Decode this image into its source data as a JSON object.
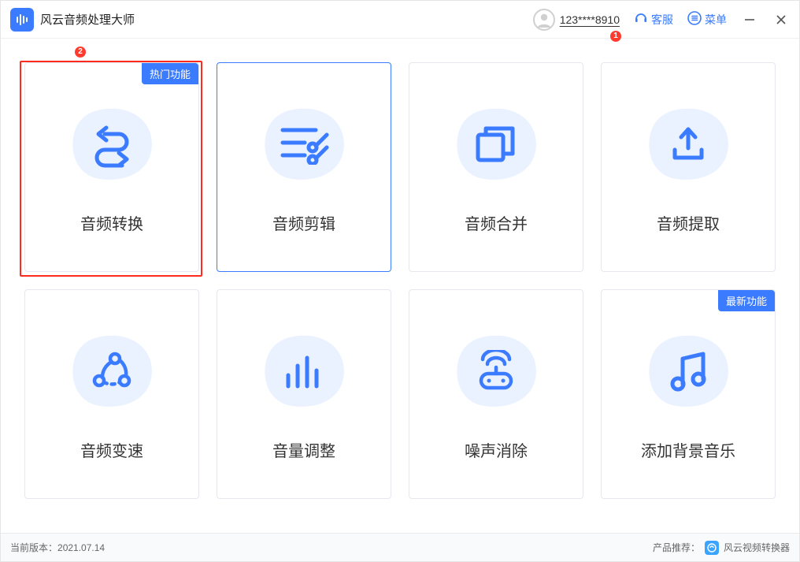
{
  "app": {
    "title": "风云音频处理大师"
  },
  "titlebar": {
    "user": "123****8910",
    "support": "客服",
    "menu": "菜单"
  },
  "annotations": {
    "badge1": "1",
    "badge2": "2"
  },
  "cards": [
    {
      "label": "音频转换",
      "tag": "热门功能"
    },
    {
      "label": "音频剪辑"
    },
    {
      "label": "音频合并"
    },
    {
      "label": "音频提取"
    },
    {
      "label": "音频变速"
    },
    {
      "label": "音量调整"
    },
    {
      "label": "噪声消除"
    },
    {
      "label": "添加背景音乐",
      "tag": "最新功能"
    }
  ],
  "footer": {
    "version_label": "当前版本：",
    "version": "2021.07.14",
    "recommend_label": "产品推荐：",
    "recommend_product": "风云视频转换器"
  }
}
